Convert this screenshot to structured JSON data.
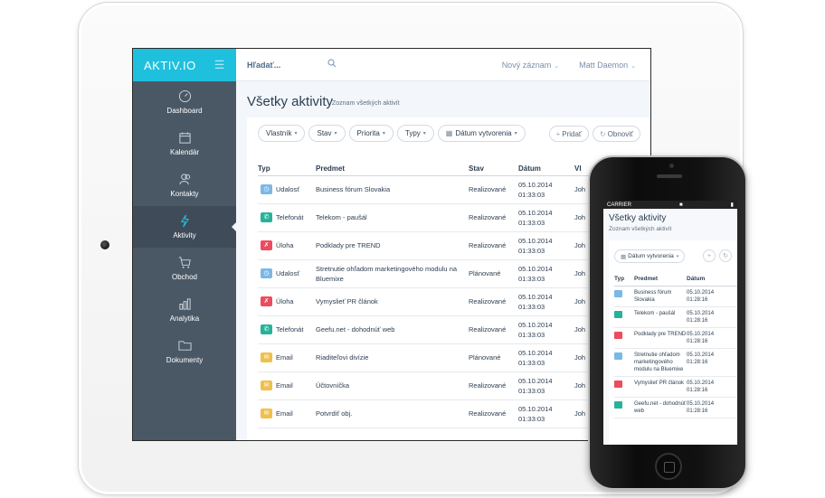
{
  "app": {
    "brand": "AKTIV.IO",
    "search_placeholder": "Hľadať...",
    "new_record": "Nový záznam",
    "user": "Matt Daemon"
  },
  "sidebar": {
    "items": [
      {
        "label": "Dashboard",
        "icon": "gauge-icon"
      },
      {
        "label": "Kalendár",
        "icon": "calendar-icon"
      },
      {
        "label": "Kontakty",
        "icon": "contacts-icon"
      },
      {
        "label": "Aktivity",
        "icon": "lightning-icon",
        "active": true
      },
      {
        "label": "Obchod",
        "icon": "cart-icon"
      },
      {
        "label": "Analytika",
        "icon": "chart-icon"
      },
      {
        "label": "Dokumenty",
        "icon": "folder-icon"
      }
    ]
  },
  "page": {
    "title": "Všetky aktivity",
    "subtitle": "Zoznam všetkých aktivít"
  },
  "filters": [
    "Vlastník",
    "Stav",
    "Priorita",
    "Typy",
    "Dátum vytvorenia"
  ],
  "actions": {
    "add": "Pridať",
    "refresh": "Obnoviť"
  },
  "table": {
    "headers": [
      "Typ",
      "Predmet",
      "Stav",
      "Dátum",
      "Vl"
    ],
    "rows": [
      {
        "type": "Udalosť",
        "kind": "event",
        "subject": "Business fórum Slovakia",
        "status": "Realizované",
        "date": "05.10.2014",
        "time": "01:33:03",
        "owner": "Joh"
      },
      {
        "type": "Telefonát",
        "kind": "call",
        "subject": "Telekom - paušál",
        "status": "Realizované",
        "date": "05.10.2014",
        "time": "01:33:03",
        "owner": "Joh"
      },
      {
        "type": "Úloha",
        "kind": "task",
        "subject": "Podklady pre TREND",
        "status": "Realizované",
        "date": "05.10.2014",
        "time": "01:33:03",
        "owner": "Joh"
      },
      {
        "type": "Udalosť",
        "kind": "event",
        "subject": "Stretnutie ohľadom marketingového modulu na Bluemixe",
        "status": "Plánované",
        "date": "05.10.2014",
        "time": "01:33:03",
        "owner": "Joh"
      },
      {
        "type": "Úloha",
        "kind": "task",
        "subject": "Vymyslieť PR článok",
        "status": "Realizované",
        "date": "05.10.2014",
        "time": "01:33:03",
        "owner": "Joh"
      },
      {
        "type": "Telefonát",
        "kind": "call",
        "subject": "Geefu.net - dohodnúť web",
        "status": "Realizované",
        "date": "05.10.2014",
        "time": "01:33:03",
        "owner": "Joh"
      },
      {
        "type": "Email",
        "kind": "email",
        "subject": "Riaditeľovi divízie",
        "status": "Plánované",
        "date": "05.10.2014",
        "time": "01:33:03",
        "owner": "Joh"
      },
      {
        "type": "Email",
        "kind": "email",
        "subject": "Účtovníčka",
        "status": "Realizované",
        "date": "05.10.2014",
        "time": "01:33:03",
        "owner": "Joh"
      },
      {
        "type": "Email",
        "kind": "email",
        "subject": "Potvrdiť obj.",
        "status": "Realizované",
        "date": "05.10.2014",
        "time": "01:33:03",
        "owner": "Joh"
      }
    ]
  },
  "type_colors": {
    "event": "#7ab8e8",
    "call": "#27b39a",
    "task": "#ee4b5e",
    "email": "#f0c04a"
  },
  "phone": {
    "carrier": "CARRIER",
    "title": "Všetky aktivity",
    "subtitle": "Zoznam všetkých aktivít",
    "filter": "Dátum vytvorenia",
    "headers": [
      "Typ",
      "Predmet",
      "Dátum"
    ],
    "rows": [
      {
        "kind": "event",
        "subject": "Business fórum Slovakia",
        "date": "05.10.2014",
        "time": "01:28:16"
      },
      {
        "kind": "call",
        "subject": "Telekom - paušál",
        "date": "05.10.2014",
        "time": "01:28:16"
      },
      {
        "kind": "task",
        "subject": "Podklady pre TREND",
        "date": "05.10.2014",
        "time": "01:28:16"
      },
      {
        "kind": "event",
        "subject": "Stretnutie ohľadom marketingového modulu na Bluemixe",
        "date": "05.10.2014",
        "time": "01:28:16"
      },
      {
        "kind": "task",
        "subject": "Vymyslieť PR článok",
        "date": "05.10.2014",
        "time": "01:28:16"
      },
      {
        "kind": "call",
        "subject": "Geefu.net - dohodnúť web",
        "date": "05.10.2014",
        "time": "01:28:16"
      }
    ]
  }
}
